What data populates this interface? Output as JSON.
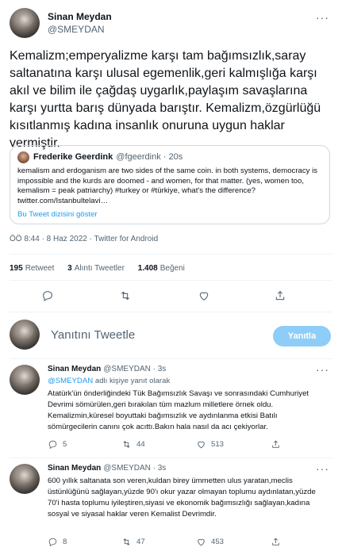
{
  "main_tweet": {
    "author_name": "Sinan Meydan",
    "author_handle": "@SMEYDAN",
    "more_icon": "more-icon",
    "text": "Kemalizm;emperyalizme karşı tam bağımsızlık,saray saltanatına karşı ulusal egemenlik,geri kalmışlığa karşı akıl ve bilim ile çağdaş uygarlık,paylaşım savaşlarına karşı yurtta barış dünyada barıştır. Kemalizm,özgürlüğü kısıtlanmış kadına insanlık onuruna uygun haklar vermiştir.",
    "quoted": {
      "author_name": "Frederike Geerdink",
      "author_handle": "@fgeerdink · 20s",
      "text": "kemalism and erdoganism are two sides of the same coin. in both systems, democracy is impossible and the kurds are doomed - and women, for that matter. (yes, women too, kemalism = peak patriarchy) #turkey or #türkiye, what's the difference? twitter.com/Istanbultelavi…",
      "show_thread": "Bu Tweet dizisini göster"
    },
    "meta": "ÖÖ 8:44 · 8 Haz 2022 · Twitter for Android",
    "stats": {
      "retweets": "195",
      "retweets_label": "Retweet",
      "quotes": "3",
      "quotes_label": "Alıntı Tweetler",
      "likes": "1.408",
      "likes_label": "Beğeni"
    },
    "actions": [
      "reply-icon",
      "retweet-icon",
      "like-icon",
      "share-icon"
    ]
  },
  "compose": {
    "placeholder": "Yanıtını Tweetle",
    "button": "Yanıtla"
  },
  "replies": [
    {
      "author_name": "Sinan Meydan",
      "author_handle": "@SMEYDAN · 3s",
      "replying_mention": "@SMEYDAN",
      "replying_suffix": " adlı kişiye yanıt olarak",
      "text": "Atatürk'ün önderliğindeki Tük Bağımsızlık Savaşı ve sonrasındaki Cumhuriyet Devrimi sömürülen,geri bırakılan tüm mazlum milletlere örnek oldu. Kemalizmin,küresel boyuttaki bağımsızlık ve aydınlanma etkisi Batılı sömürgecilerin canını çok acıttı.Bakın hala nasıl da acı çekiyorlar.",
      "reply_count": "5",
      "retweet_count": "44",
      "like_count": "513"
    },
    {
      "author_name": "Sinan Meydan",
      "author_handle": "@SMEYDAN · 3s",
      "text": "600 yıllık saltanata son veren,kuldan birey ümmetten ulus yaratan,meclis üstünlüğünü sağlayan,yüzde 90'ı okur yazar olmayan toplumu aydınlatan,yüzde 70'i hasta toplumu iyileştiren,siyasi ve ekonomik bağımsızlığı sağlayan,kadına sosyal ve siyasal haklar veren Kemalist Devrimdir.",
      "reply_count": "8",
      "retweet_count": "47",
      "like_count": "453"
    }
  ],
  "colors": {
    "accent": "#1d9bf0",
    "reply_button": "#8ecdf8",
    "secondary_text": "#536471",
    "border": "#cfd9de"
  }
}
